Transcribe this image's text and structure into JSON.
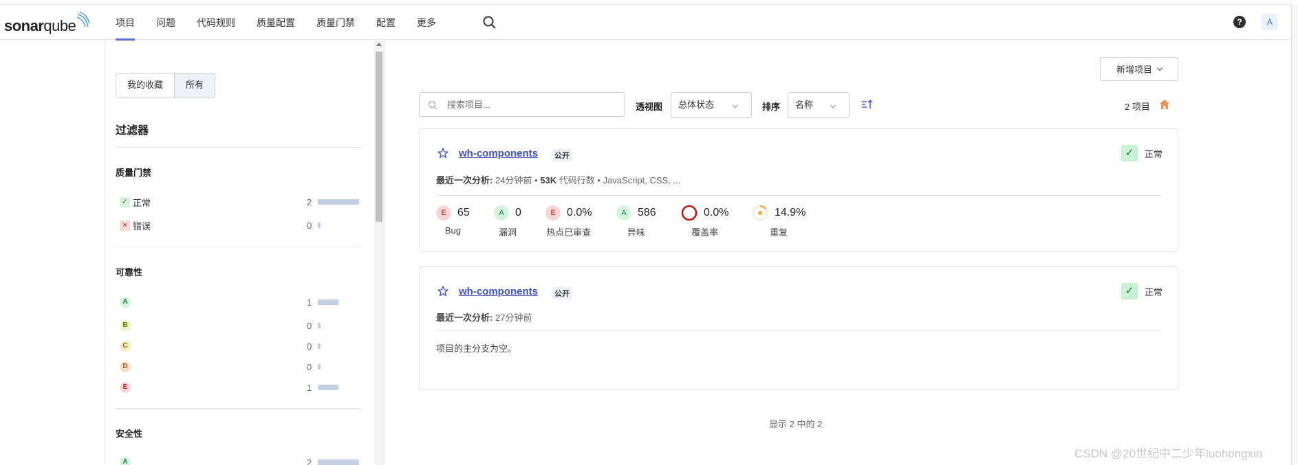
{
  "app": {
    "logo_text_bold": "sonar",
    "logo_text_light": "qube",
    "avatar_letter": "A",
    "help_glyph": "?"
  },
  "nav": {
    "items": [
      {
        "label": "项目",
        "active": true
      },
      {
        "label": "问题"
      },
      {
        "label": "代码规则"
      },
      {
        "label": "质量配置"
      },
      {
        "label": "质量门禁"
      },
      {
        "label": "配置"
      },
      {
        "label": "更多"
      }
    ]
  },
  "sidebar": {
    "toggle": {
      "favorites": "我的收藏",
      "all": "所有",
      "selected": "all"
    },
    "title": "过滤器",
    "quality_gate": {
      "title": "质量门禁",
      "rows": [
        {
          "icon": "check-icon",
          "glyph": "✓",
          "label": "正常",
          "count": "2",
          "fraction": 1.0
        },
        {
          "icon": "cross-icon",
          "glyph": "×",
          "label": "错误",
          "count": "0",
          "fraction": 0
        }
      ]
    },
    "reliability": {
      "title": "可靠性",
      "rows": [
        {
          "grade": "A",
          "count": "1",
          "fraction": 0.5
        },
        {
          "grade": "B",
          "count": "0",
          "fraction": 0
        },
        {
          "grade": "C",
          "count": "0",
          "fraction": 0
        },
        {
          "grade": "D",
          "count": "0",
          "fraction": 0
        },
        {
          "grade": "E",
          "count": "1",
          "fraction": 0.5
        }
      ]
    },
    "security": {
      "title": "安全性",
      "rows": [
        {
          "grade": "A",
          "count": "2",
          "fraction": 1.0
        }
      ]
    }
  },
  "toolbar": {
    "new_project_label": "新增项目",
    "search_placeholder": "搜索项目...",
    "perspective_label": "透视图",
    "perspective_value": "总体状态",
    "sort_label": "排序",
    "sort_value": "名称",
    "project_count_text": "2 项目"
  },
  "projects": [
    {
      "name": "wh-components",
      "visibility": "公开",
      "status": "正常",
      "meta_label": "最近一次分析:",
      "meta_time": "24分钟前",
      "meta_sep1": "•",
      "meta_loc": "53K",
      "meta_loc_label": "代码行数",
      "meta_sep2": "•",
      "meta_langs": "JavaScript, CSS, ...",
      "metrics": {
        "bugs": {
          "grade": "E",
          "value": "65",
          "label": "Bug"
        },
        "vulnerabilities": {
          "grade": "A",
          "value": "0",
          "label": "漏洞"
        },
        "hotspots": {
          "grade": "E",
          "value": "0.0%",
          "label": "热点已审查"
        },
        "code_smells": {
          "grade": "A",
          "value": "586",
          "label": "异味"
        },
        "coverage": {
          "value": "0.0%",
          "label": "覆盖率",
          "fraction": 0.0
        },
        "duplications": {
          "value": "14.9%",
          "label": "重复",
          "fraction": 0.149
        }
      }
    },
    {
      "name": "wh-components",
      "visibility": "公开",
      "status": "正常",
      "meta_label": "最近一次分析:",
      "meta_time": "27分钟前",
      "empty_message": "项目的主分支为空。"
    }
  ],
  "footer": {
    "shown_text": "显示 2 中的 2"
  },
  "watermark": "CSDN @20世纪中二少年luohongxin",
  "colors": {
    "accent": "#5e6bc9",
    "link": "#3f52b6",
    "ok": "#c9f1d3",
    "bar": "#c4cfe4"
  }
}
